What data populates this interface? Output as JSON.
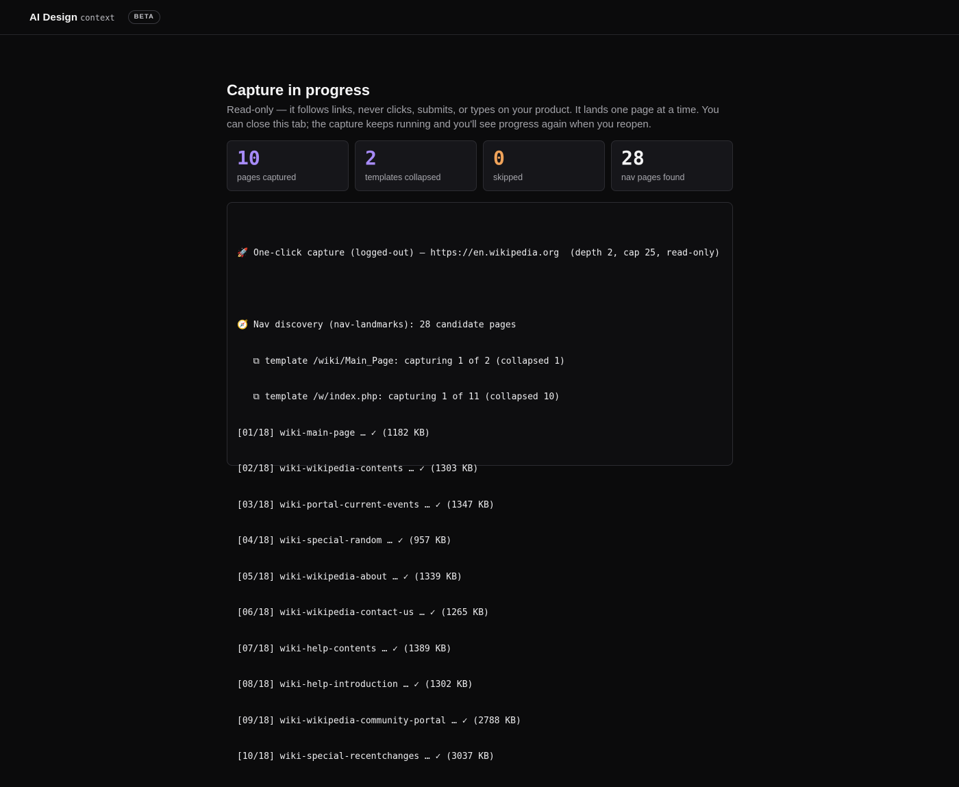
{
  "header": {
    "brand": "AI Design",
    "brand_sub": "context",
    "badge": "BETA"
  },
  "capture": {
    "title": "Capture in progress",
    "description": "Read-only — it follows links, never clicks, submits, or types on your product. It lands one page at a time. You can close this tab; the capture keeps running and you'll see progress again when you reopen."
  },
  "stats": [
    {
      "value": "10",
      "label": "pages captured",
      "color": "#a78bfa"
    },
    {
      "value": "2",
      "label": "templates collapsed",
      "color": "#a78bfa"
    },
    {
      "value": "0",
      "label": "skipped",
      "color": "#f0a35a"
    },
    {
      "value": "28",
      "label": "nav pages found",
      "color": "#f4f4f5"
    }
  ],
  "log": {
    "header_line": "🚀 One-click capture (logged-out) – https://en.wikipedia.org  (depth 2, cap 25, read-only)",
    "discovery_line": "🧭 Nav discovery (nav-landmarks): 28 candidate pages",
    "template_lines": [
      "   ⧉ template /wiki/Main_Page: capturing 1 of 2 (collapsed 1)",
      "   ⧉ template /w/index.php: capturing 1 of 11 (collapsed 10)"
    ],
    "page_lines": [
      "[01/18] wiki-main-page … ✓ (1182 KB)",
      "[02/18] wiki-wikipedia-contents … ✓ (1303 KB)",
      "[03/18] wiki-portal-current-events … ✓ (1347 KB)",
      "[04/18] wiki-special-random … ✓ (957 KB)",
      "[05/18] wiki-wikipedia-about … ✓ (1339 KB)",
      "[06/18] wiki-wikipedia-contact-us … ✓ (1265 KB)",
      "[07/18] wiki-help-contents … ✓ (1389 KB)",
      "[08/18] wiki-help-introduction … ✓ (1302 KB)",
      "[09/18] wiki-wikipedia-community-portal … ✓ (2788 KB)",
      "[10/18] wiki-special-recentchanges … ✓ (3037 KB)"
    ]
  }
}
